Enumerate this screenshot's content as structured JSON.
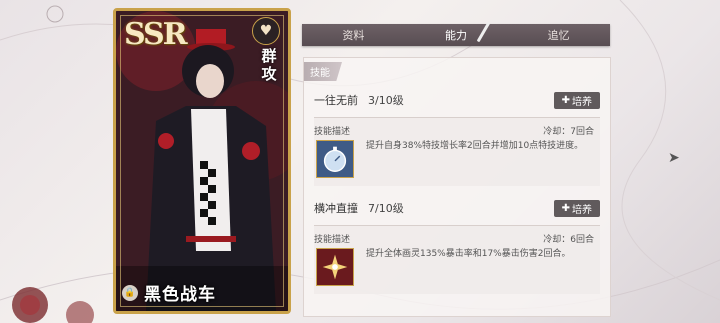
{
  "card": {
    "rarity": "SSR",
    "type_label": "群攻",
    "name": "黑色战车"
  },
  "tabs": [
    {
      "label": "资料"
    },
    {
      "label": "能力"
    },
    {
      "label": "追忆"
    }
  ],
  "section": {
    "label": "技能"
  },
  "skills": [
    {
      "name": "一往无前",
      "level": "3/10级",
      "upgrade_label": "培养",
      "desc_label": "技能描述",
      "cooldown": "冷却：7回合",
      "description": "提升自身38%特技增长率2回合并增加10点特技进度。"
    },
    {
      "name": "横冲直撞",
      "level": "7/10级",
      "upgrade_label": "培养",
      "desc_label": "技能描述",
      "cooldown": "冷却：6回合",
      "description": "提升全体画灵135%暴击率和17%暴击伤害2回合。"
    }
  ]
}
